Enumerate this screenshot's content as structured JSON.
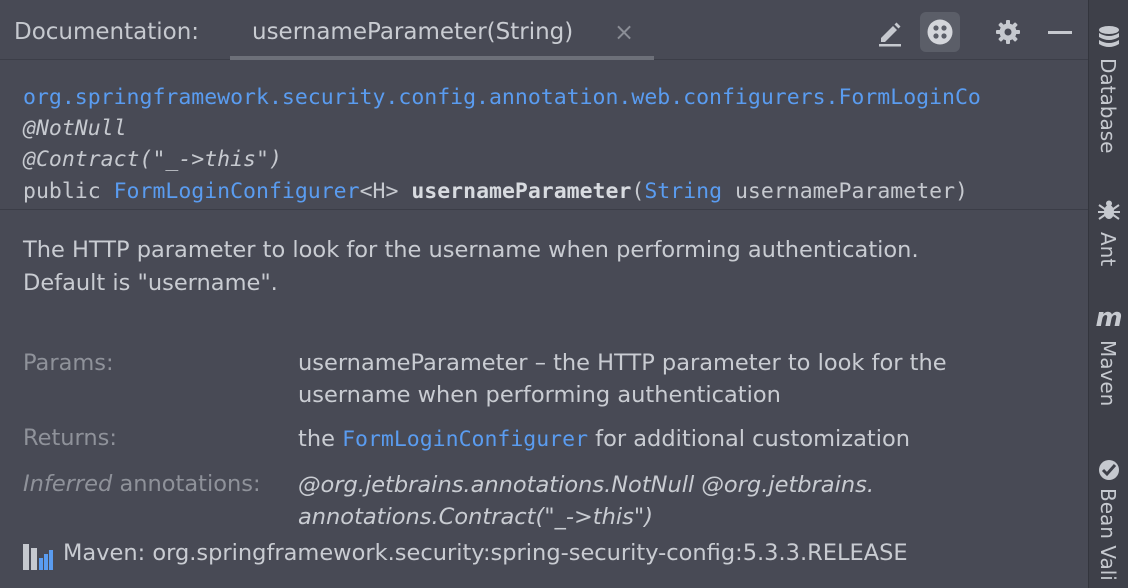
{
  "header": {
    "label": "Documentation:",
    "tab_label": "usernameParameter(String)",
    "tab_close": "×"
  },
  "toolbar": {
    "edit_icon": "pencil-icon",
    "view_icon": "view-mode-icon",
    "settings_icon": "gear-icon",
    "minimize_icon": "minimize-icon"
  },
  "signature": {
    "class_path": "org.springframework.security.config.annotation.web.configurers.FormLoginCo",
    "annotation_notnull": "@NotNull",
    "annotation_contract": "@Contract(\"_->this\")",
    "modifier": "public ",
    "return_type": "FormLoginConfigurer",
    "generic": "<H> ",
    "method_name": "usernameParameter",
    "open_paren": "(",
    "param_type": "String",
    "param_name": " usernameParameter)"
  },
  "description": {
    "line1": "The HTTP parameter to look for the username when performing authentication.",
    "line2": "Default is \"username\"."
  },
  "params": {
    "label": "Params:",
    "value_line1": "usernameParameter – the HTTP parameter to look for the",
    "value_line2": "username when performing authentication"
  },
  "returns": {
    "label": "Returns:",
    "prefix": "the ",
    "link": "FormLoginConfigurer",
    "suffix": " for additional customization"
  },
  "inferred": {
    "label_italic": "Inferred",
    "label_rest": " annotations:",
    "value_line1": "@org.jetbrains.annotations.NotNull @org.jetbrains.",
    "value_line2": "annotations.Contract(\"_->this\")"
  },
  "footer": {
    "icon": "maven-library-icon",
    "text": "Maven: org.springframework.security:spring-security-config:5.3.3.RELEASE"
  },
  "sidebar": {
    "items": [
      {
        "label": "Database",
        "icon": "database-icon"
      },
      {
        "label": "Ant",
        "icon": "ant-icon"
      },
      {
        "label": "Maven",
        "icon": "maven-icon"
      },
      {
        "label": "Bean Vali",
        "icon": "bean-validation-icon"
      }
    ]
  },
  "colors": {
    "background": "#484a55",
    "link": "#5a9cf0",
    "text": "#c9ccd2",
    "muted": "#8f929a"
  }
}
